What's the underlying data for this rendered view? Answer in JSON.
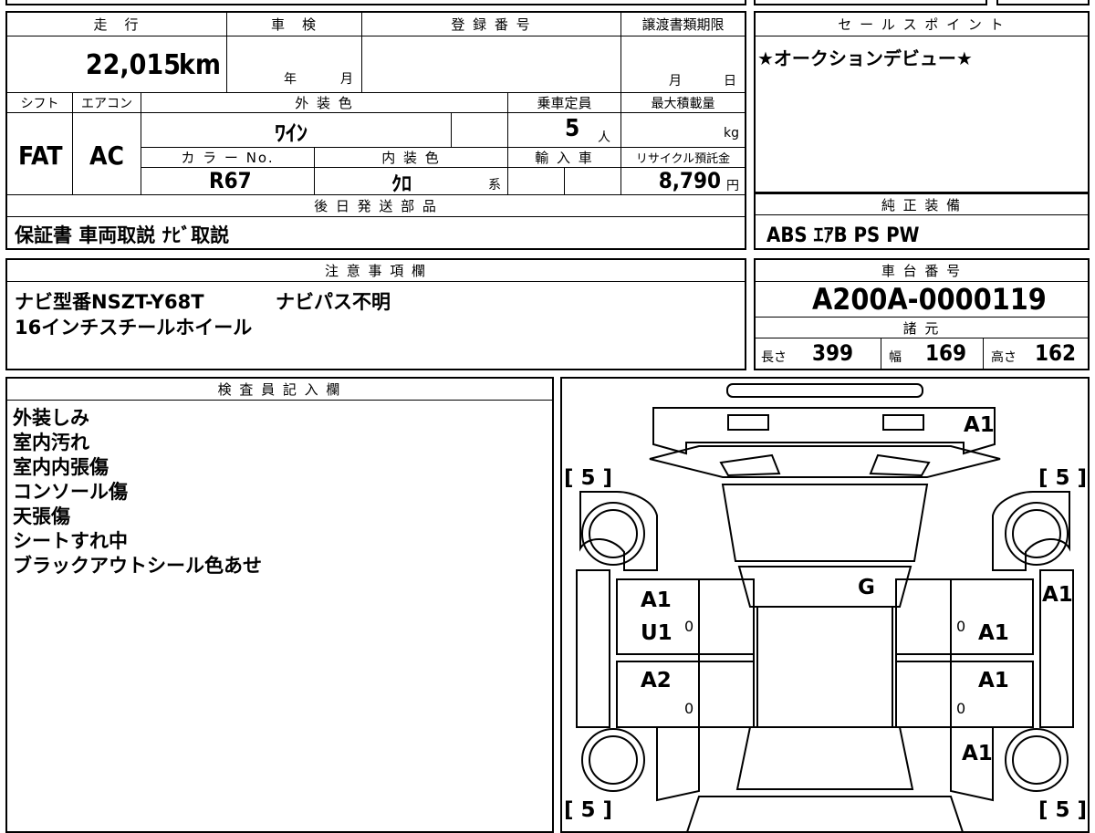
{
  "vehicle": {
    "mileage_label": "走　行",
    "mileage_value": "22,015",
    "mileage_unit": "km",
    "inspection_label": "車　検",
    "inspection_year_unit": "年",
    "inspection_month_unit": "月",
    "registration_label": "登 録 番 号",
    "registration_value": "",
    "transfer_deadline_label": "譲渡書類期限",
    "transfer_month_unit": "月",
    "transfer_day_unit": "日",
    "shift_label": "シフト",
    "shift_value": "FAT",
    "aircon_label": "エアコン",
    "aircon_value": "AC",
    "exterior_color_label": "外 装 色",
    "exterior_color_value": "ﾜｲﾝ",
    "capacity_label": "乗車定員",
    "capacity_value": "5",
    "capacity_unit": "人",
    "max_load_label": "最大積載量",
    "max_load_unit": "kg",
    "color_no_label": "カ ラ ー No.",
    "color_no_value": "R67",
    "interior_color_label": "内 装 色",
    "interior_color_value": "ｸﾛ",
    "interior_color_unit": "系",
    "import_label": "輸 入 車",
    "recycle_label": "リサイクル預託金",
    "recycle_value": "8,790",
    "recycle_unit": "円"
  },
  "later_parts": {
    "label": "後 日 発 送 部 品",
    "value": "保証書 車両取説 ﾅﾋﾞ取説"
  },
  "sales_point": {
    "label": "セ ー ル ス ポ イ ン ト",
    "value": "★オークションデビュー★"
  },
  "genuine_equipment": {
    "label": "純 正 装 備",
    "value": "ABS ｴｱB PS PW"
  },
  "notes": {
    "label": "注 意 事 項 欄",
    "line1a": "ナビ型番NSZT-Y68T",
    "line1b": "ナビパス不明",
    "line2": "16インチスチールホイール"
  },
  "chassis": {
    "label": "車 台 番 号",
    "value": "A200A-0000119"
  },
  "specs": {
    "label": "諸 元",
    "length_label": "長さ",
    "length_value": "399",
    "width_label": "幅",
    "width_value": "169",
    "height_label": "高さ",
    "height_value": "162"
  },
  "inspector": {
    "label": "検 査 員 記 入 欄",
    "items": [
      "外装しみ",
      "室内汚れ",
      "室内内張傷",
      "コンソール傷",
      "天張傷",
      "シートすれ中",
      "ブラックアウトシール色あせ"
    ]
  },
  "diagram": {
    "tire_fl": "[ 5 ]",
    "tire_fr": "[ 5 ]",
    "tire_rl": "[ 5 ]",
    "tire_rr": "[ 5 ]",
    "front_bumper_mark": "A1",
    "right_front_fender_mark": "A1",
    "windshield_mark": "G",
    "left_front_door_mark1": "A1",
    "left_front_door_mark2": "U1",
    "right_front_door_mark": "A1",
    "left_rear_door_mark": "A2",
    "right_rear_door_mark": "A1",
    "right_rear_fender_mark": "A1",
    "door_zero_1": "0",
    "door_zero_2": "0",
    "door_zero_3": "0",
    "door_zero_4": "0"
  }
}
